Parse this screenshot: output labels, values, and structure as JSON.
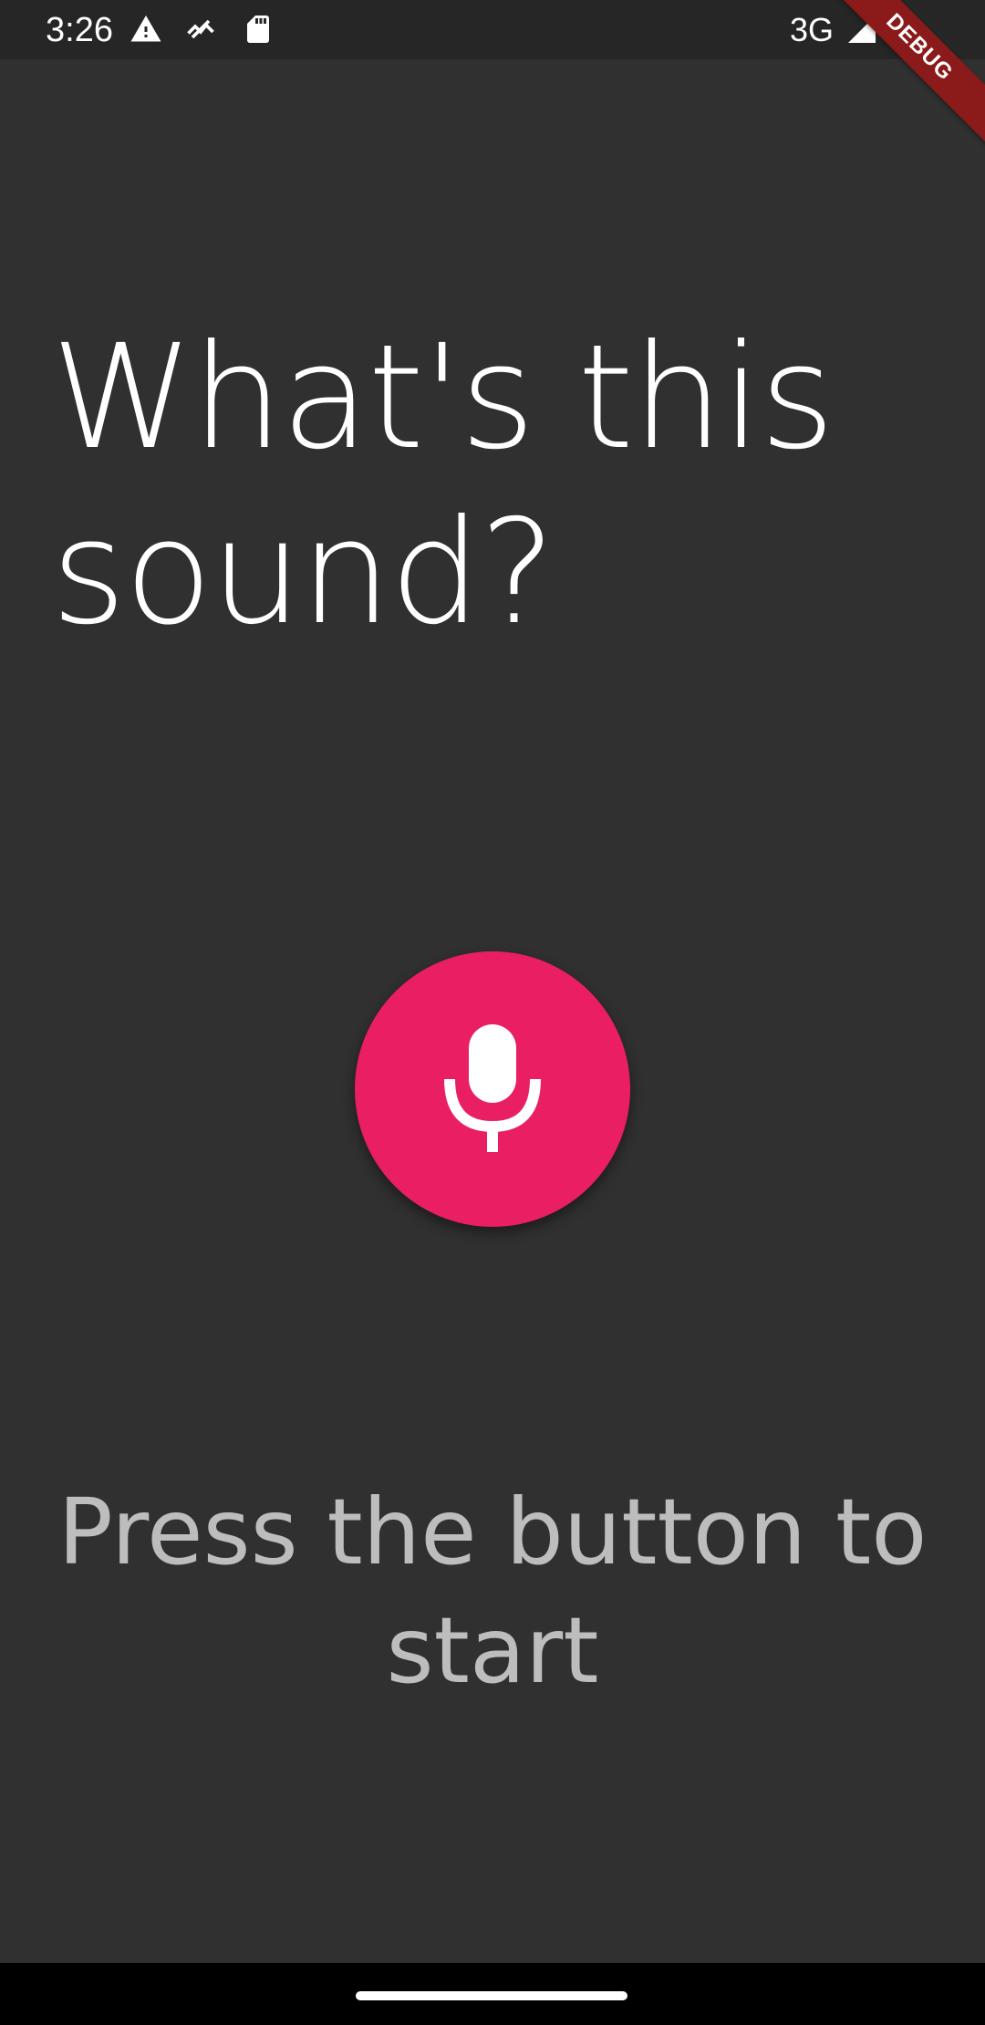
{
  "status_bar": {
    "time": "3:26",
    "network": "3G",
    "icons": [
      "warning-icon",
      "signal-wave-icon",
      "sd-card-icon",
      "cell-signal-icon",
      "battery-icon"
    ]
  },
  "debug_banner": {
    "label": "DEBUG"
  },
  "main": {
    "title_line1": "What's this",
    "title_line2": "sound?",
    "record_button_icon": "microphone-icon",
    "hint_line1": "Press the button to",
    "hint_line2": "start"
  },
  "colors": {
    "background": "#303030",
    "accent": "#e91e63",
    "title_text": "#ffffff",
    "hint_text": "#bdbdbd",
    "debug_banner": "#8b1a1a"
  }
}
